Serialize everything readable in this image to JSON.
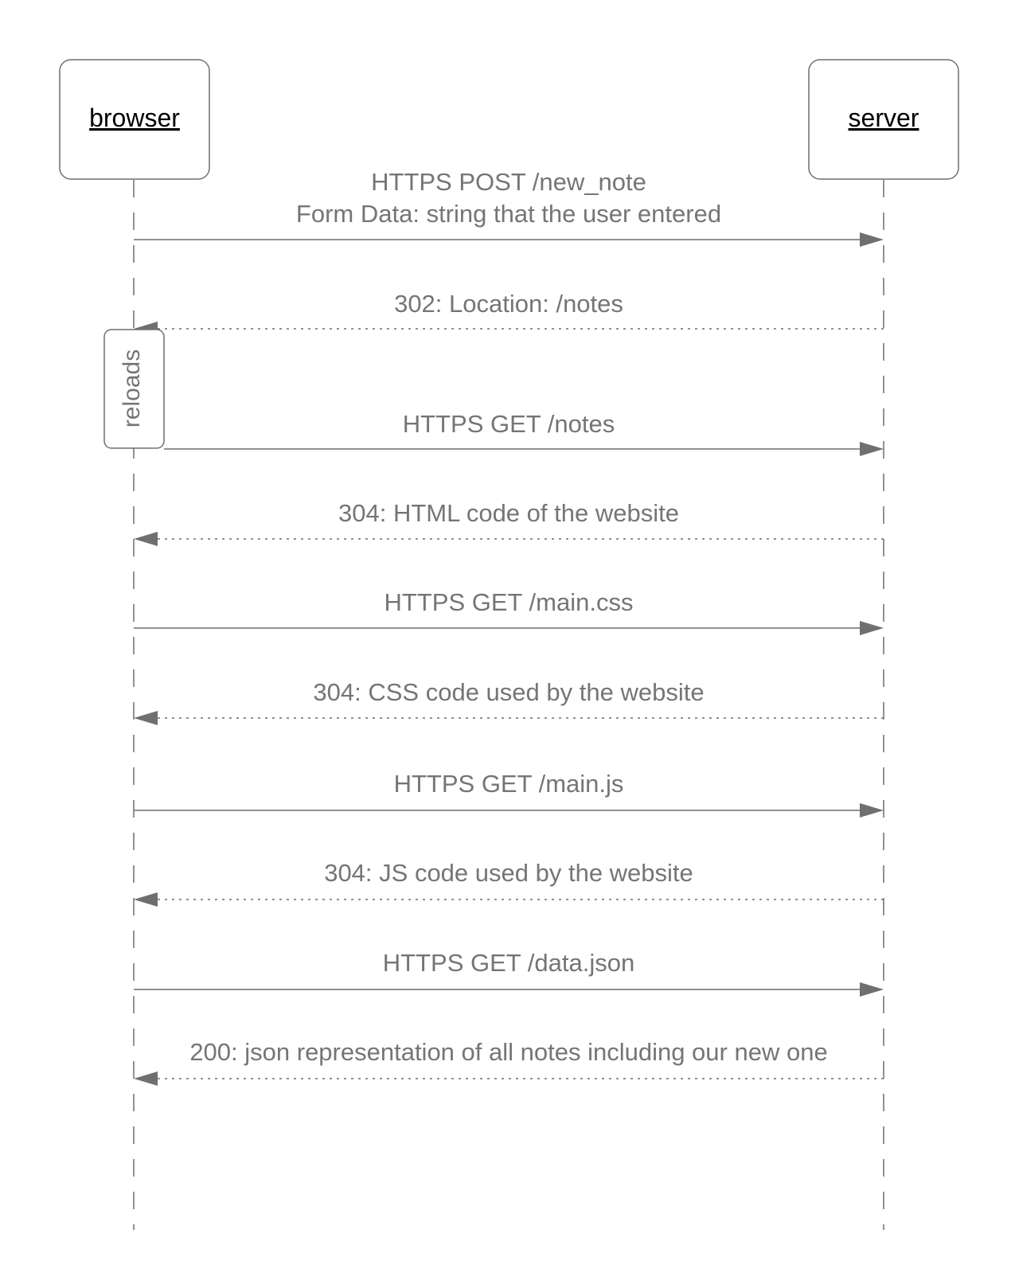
{
  "actors": [
    {
      "id": "browser",
      "label": "browser"
    },
    {
      "id": "server",
      "label": "server"
    }
  ],
  "activation": {
    "label": "reloads"
  },
  "messages": [
    {
      "from": "browser",
      "to": "server",
      "style": "solid",
      "lines": [
        "HTTPS POST /new_note",
        "Form Data: string that the user entered"
      ]
    },
    {
      "from": "server",
      "to": "browser",
      "style": "dotted",
      "lines": [
        "302: Location: /notes"
      ]
    },
    {
      "from": "browser",
      "to": "server",
      "style": "solid",
      "lines": [
        "HTTPS GET /notes"
      ]
    },
    {
      "from": "server",
      "to": "browser",
      "style": "dotted",
      "lines": [
        "304: HTML code of the website"
      ]
    },
    {
      "from": "browser",
      "to": "server",
      "style": "solid",
      "lines": [
        "HTTPS GET /main.css"
      ]
    },
    {
      "from": "server",
      "to": "browser",
      "style": "dotted",
      "lines": [
        "304: CSS code used by the website"
      ]
    },
    {
      "from": "browser",
      "to": "server",
      "style": "solid",
      "lines": [
        "HTTPS GET /main.js"
      ]
    },
    {
      "from": "server",
      "to": "browser",
      "style": "dotted",
      "lines": [
        "304: JS code used by the website"
      ]
    },
    {
      "from": "browser",
      "to": "server",
      "style": "solid",
      "lines": [
        "HTTPS GET /data.json"
      ]
    },
    {
      "from": "server",
      "to": "browser",
      "style": "dotted",
      "lines": [
        "200: json representation of all notes including our new one"
      ]
    }
  ],
  "colors": {
    "line": "#6f6f6f",
    "label": "#757575",
    "actor_label": "#000000"
  }
}
